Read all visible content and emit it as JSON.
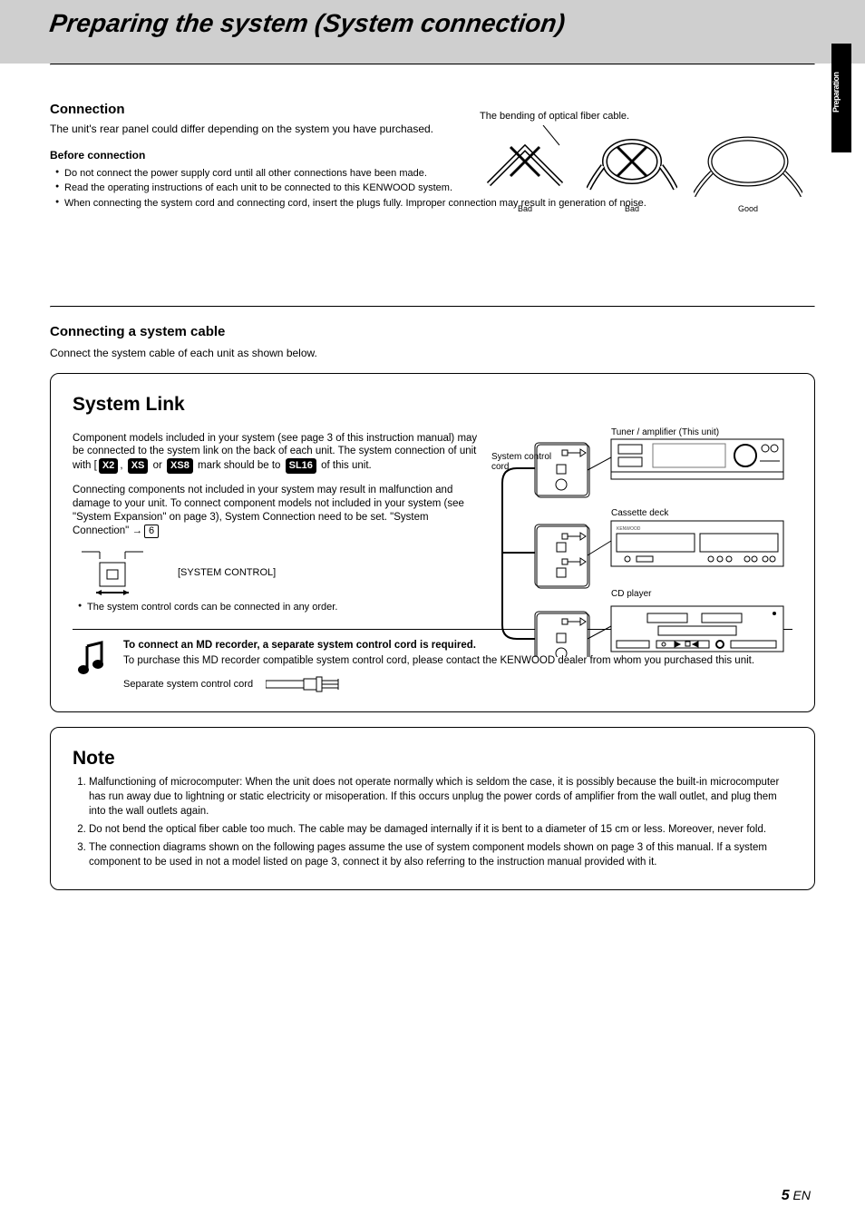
{
  "header": {
    "title": "Preparing the system (System connection)",
    "side_tab": "Preparation"
  },
  "intro": {
    "title": "Connection",
    "text": "The unit's rear panel could differ depending on the system you have purchased.",
    "sub_title": "Before connection",
    "bullets": [
      "Do not connect the power supply cord until all other connections have been made.",
      "Read the operating instructions of each unit to be connected to this KENWOOD system.",
      "When connecting the system cord and connecting cord, insert the plugs fully. Improper connection may result in generation of noise."
    ],
    "right_caption": "The bending of optical fiber cable.",
    "bend_labels": [
      "Bad",
      "Bad",
      "Good"
    ]
  },
  "cable": {
    "title": "Connecting a system cable",
    "subtitle": "Connect the system cable of each unit as shown below."
  },
  "syslink": {
    "heading": "System Link",
    "para1_plain": "Component models included in your system (see page 3 of this instruction manual) may be connected to the system link on the back of each unit. The system connection of unit with [",
    "badge_x2": "X2",
    "badge_xs": "XS",
    "comma": ", ",
    "or": " or ",
    "badge_xs8": "XS8",
    "para1_mid": " mark should be to ",
    "badge_sl16": "SL16",
    "para1_end": " of this unit.",
    "para2_plain": "Connecting components not included in your system may result in malfunction and damage to your unit. To connect component models not included in your system (see \"System Expansion\" on page 3), System Connection need to be set. \"System Connection\" ",
    "page_ref_arrow": "→",
    "page_ref": "6",
    "jack_label": "[SYSTEM CONTROL]",
    "note_bullet": "The system control cords can be connected in any order.",
    "devices": {
      "tuner": "Tuner / amplifier (This unit)",
      "cassette": "Cassette deck",
      "cd": "CD player",
      "cord_label": "System control cord"
    },
    "music": {
      "line1": "To connect an MD recorder, a separate system control cord is required.",
      "line2": "To purchase this MD recorder compatible system control cord, please contact the KENWOOD dealer from whom you purchased this unit.",
      "plug_caption": "Separate system control cord"
    }
  },
  "note": {
    "heading": "Note",
    "items": [
      "Malfunctioning of microcomputer: When the unit does not operate normally which is seldom the case, it is possibly because the built-in microcomputer has run away due to lightning or static electricity or misoperation. If this occurs unplug the power cords of amplifier from the wall outlet, and plug them into the wall outlets again.",
      "Do not bend the optical fiber cable too much. The cable may be damaged internally if it is bent to a diameter of 15 cm or less. Moreover, never fold.",
      "The connection diagrams shown on the following pages assume the use of system component models shown on page 3 of this manual. If a system component to be used in not a model listed on page 3, connect it by also referring to the instruction manual provided with it."
    ]
  },
  "page_number": {
    "label": "EN",
    "num": "5"
  }
}
